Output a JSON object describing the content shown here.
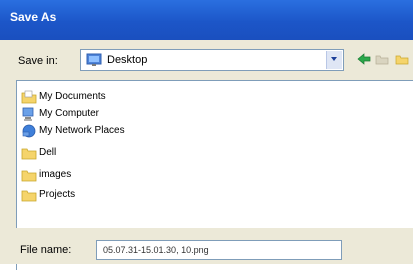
{
  "window": {
    "title": "Save As"
  },
  "toolbar": {
    "save_in_label": "Save in:",
    "location": "Desktop"
  },
  "files": [
    {
      "label": "My Documents",
      "icon": "my-documents-icon"
    },
    {
      "label": "My Computer",
      "icon": "my-computer-icon"
    },
    {
      "label": "My Network Places",
      "icon": "network-places-icon"
    },
    {
      "label": "Dell",
      "icon": "folder-icon"
    },
    {
      "label": "images",
      "icon": "folder-icon"
    },
    {
      "label": "Projects",
      "icon": "folder-icon"
    }
  ],
  "bottom": {
    "filename_label": "File name:",
    "filename_value": "05.07.31-15.01.30, 10.png"
  },
  "colors": {
    "title_bar": "#1c56c8",
    "dialog_bg": "#ece9d8",
    "folder": "#f5d46b",
    "back_arrow": "#2aa84a"
  }
}
